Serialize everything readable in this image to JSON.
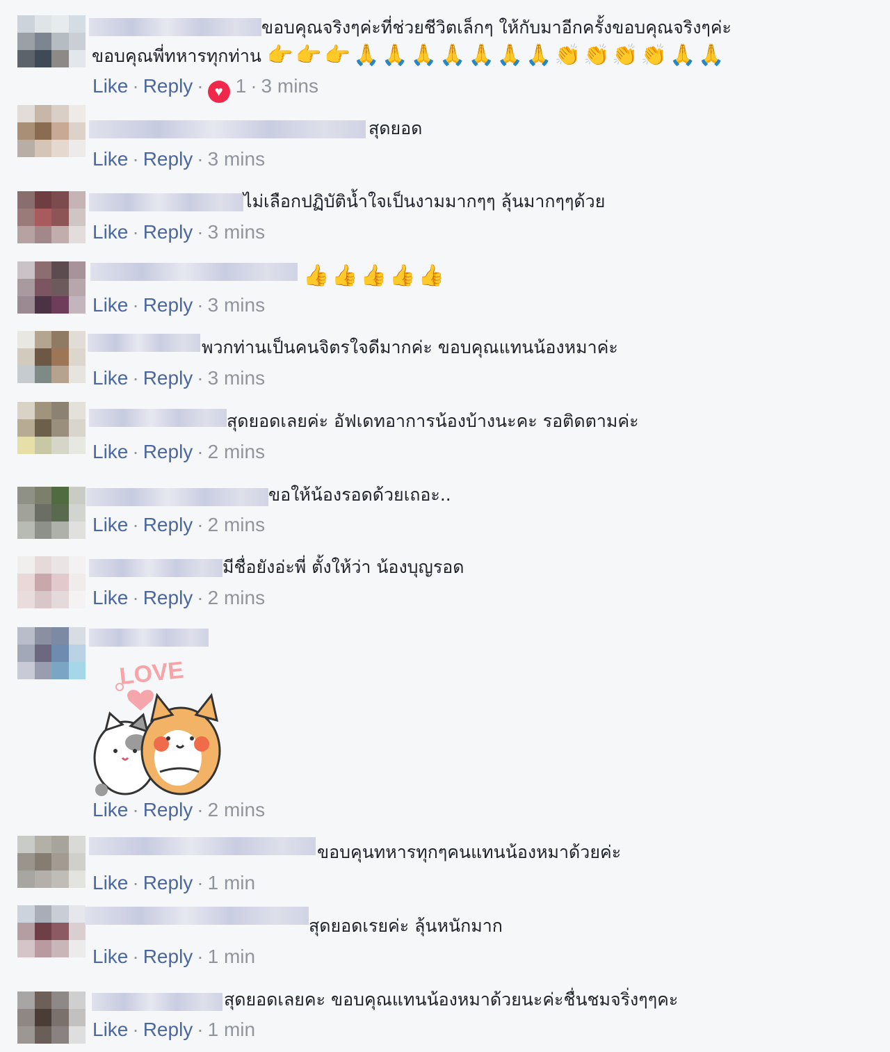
{
  "actions": {
    "like": "Like",
    "reply": "Reply",
    "sep": "·"
  },
  "comments": [
    {
      "line1": "ขอบคุณจริงๆค่ะที่ช่วยชีวิตเล็กๆ ให้กับมาอีกครั้งขอบคุณจริงๆค่ะ",
      "line2": "ขอบคุณพี่ทหารทุกท่าน",
      "emojis": [
        "👉",
        "👉",
        "👉",
        "🙏",
        "🙏",
        "🙏",
        "🙏",
        "🙏",
        "🙏",
        "🙏",
        "👏",
        "👏",
        "👏",
        "👏",
        "🙏",
        "🙏"
      ],
      "reaction_count": "1",
      "time": "3 mins"
    },
    {
      "text": "สุดยอด",
      "time": "3 mins"
    },
    {
      "text": "ไม่เลือกปฏิบัติน้ำใจเป็นงามมากๆๆ ลุ้นมากๆๆด้วย",
      "time": "3 mins"
    },
    {
      "emojis": [
        "👍",
        "👍",
        "👍",
        "👍",
        "👍"
      ],
      "time": "3 mins"
    },
    {
      "text": "พวกท่านเป็นคนจิตรใจดีมากค่ะ ขอบคุณแทนน้องหมาค่ะ",
      "time": "3 mins"
    },
    {
      "text": "สุดยอดเลยค่ะ อัฟเดทอาการน้องบ้างนะคะ รอติดตามค่ะ",
      "time": "2 mins"
    },
    {
      "text": "ขอให้น้องรอดด้วยเถอะ..",
      "time": "2 mins"
    },
    {
      "text": "มีชื่อยังอ่ะพี่ ตั้งให้ว่า น้องบุญรอด",
      "time": "2 mins"
    },
    {
      "sticker_text": "LOVE",
      "time": "2 mins"
    },
    {
      "text": "ขอบคุนทหารทุกๆคนแทนน้องหมาด้วยค่ะ",
      "time": "1 min"
    },
    {
      "text": "สุดยอดเรยค่ะ ลุ้นหนักมาก",
      "time": "1 min"
    },
    {
      "text": "สุดยอดเลยคะ ขอบคุณแทนน้องหมาด้วยนะค่ะชื่นชมจริ่งๆๆคะ",
      "time": "1 min"
    }
  ],
  "colors": {
    "link": "#4b67a1",
    "meta": "#90949c",
    "text": "#1d2129",
    "heart": "#f0284a",
    "background": "#f6f7f9"
  }
}
